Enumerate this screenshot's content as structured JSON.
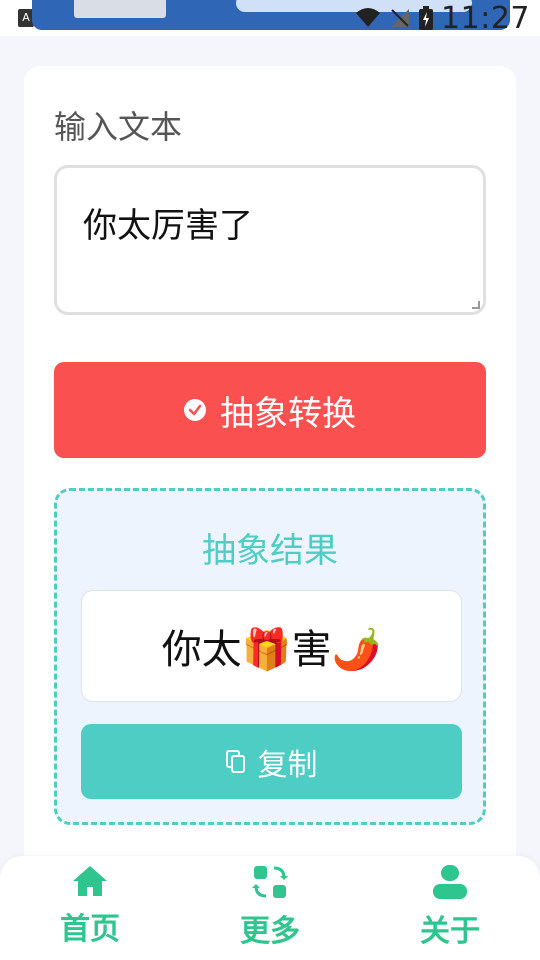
{
  "status_bar": {
    "time": "11:27"
  },
  "input": {
    "label": "输入文本",
    "value": "你太厉害了"
  },
  "convert_button": {
    "label": "抽象转换"
  },
  "result": {
    "title": "抽象结果",
    "output": "你太🎁害🌶️",
    "copy_label": "复制"
  },
  "bottom_nav": {
    "items": [
      {
        "label": "首页",
        "icon": "home-icon"
      },
      {
        "label": "更多",
        "icon": "swap-icon"
      },
      {
        "label": "关于",
        "icon": "user-icon"
      }
    ]
  },
  "colors": {
    "accent_red": "#fa5150",
    "accent_teal": "#4ecdc4",
    "nav_green": "#2ec58f"
  }
}
